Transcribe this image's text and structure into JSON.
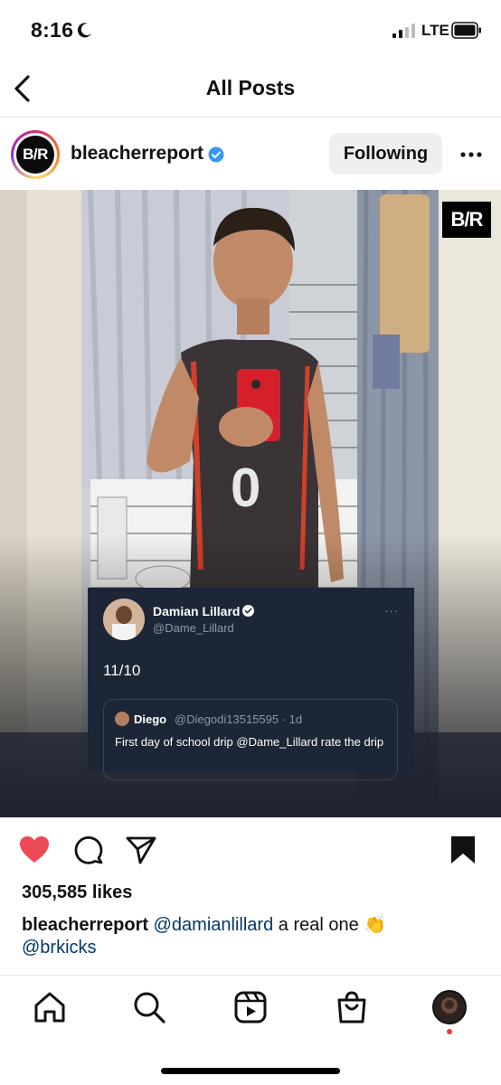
{
  "status_bar": {
    "time": "8:16",
    "network": "LTE",
    "icons": [
      "moon-icon",
      "signal-icon",
      "battery-icon"
    ]
  },
  "header": {
    "title": "All Posts",
    "back_icon": "chevron-left-icon"
  },
  "post": {
    "avatar_text": "B/R",
    "username": "bleacherreport",
    "verified": true,
    "follow_label": "Following",
    "more_icon": "more-horizontal-icon",
    "media": {
      "watermark": "B/R",
      "tweet": {
        "author_name": "Damian Lillard",
        "author_handle": "@Dame_Lillard",
        "text": "11/10",
        "quoted": {
          "name": "Diego",
          "handle_time": "@Diegodi13515595 · 1d",
          "text": "First day of school drip @Dame_Lillard rate the drip"
        }
      }
    },
    "actions": {
      "like_icon": "heart-filled-icon",
      "comment_icon": "comment-icon",
      "share_icon": "send-icon",
      "save_icon": "bookmark-filled-icon"
    },
    "likes": "305,585 likes",
    "caption": {
      "username": "bleacherreport",
      "mention1": "@damianlillard",
      "text": " a real one 👏",
      "mention2": "@brkicks"
    }
  },
  "tab_bar": {
    "items": [
      "home-icon",
      "search-icon",
      "reels-icon",
      "shop-icon",
      "profile-avatar"
    ]
  },
  "colors": {
    "like_red": "#ed4956",
    "verified_blue": "#3897f0",
    "mention_blue": "#00376b",
    "notification_dot": "#ff3040"
  }
}
